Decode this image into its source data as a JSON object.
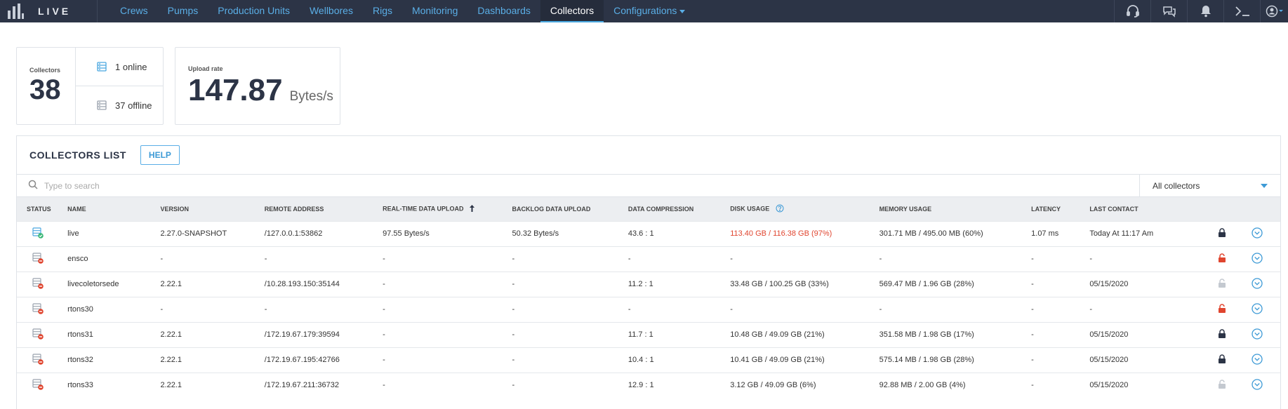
{
  "nav": {
    "brand": "LIVE",
    "items": [
      {
        "label": "Crews"
      },
      {
        "label": "Pumps"
      },
      {
        "label": "Production Units"
      },
      {
        "label": "Wellbores"
      },
      {
        "label": "Rigs"
      },
      {
        "label": "Monitoring"
      },
      {
        "label": "Dashboards"
      },
      {
        "label": "Collectors",
        "active": true
      },
      {
        "label": "Configurations"
      }
    ],
    "right_icons": [
      "headset-icon",
      "chat-icon",
      "bell-icon",
      "terminal-icon",
      "user-icon"
    ]
  },
  "summary": {
    "collectors_label": "Collectors",
    "collectors_count": "38",
    "online": "1 online",
    "offline": "37 offline",
    "upload_label": "Upload rate",
    "upload_value": "147.87",
    "upload_unit": "Bytes/s"
  },
  "list": {
    "title": "COLLECTORS LIST",
    "help_label": "HELP",
    "search_placeholder": "Type to search",
    "filter_value": "All collectors",
    "columns": {
      "status": "STATUS",
      "name": "NAME",
      "version": "VERSION",
      "remote": "REMOTE ADDRESS",
      "realtime": "REAL-TIME DATA UPLOAD",
      "backlog": "BACKLOG DATA UPLOAD",
      "compression": "DATA COMPRESSION",
      "disk": "DISK USAGE",
      "memory": "MEMORY USAGE",
      "latency": "LATENCY",
      "last": "LAST CONTACT"
    },
    "rows": [
      {
        "status": "online",
        "name": "live",
        "version": "2.27.0-SNAPSHOT",
        "remote": "/127.0.0.1:53862",
        "realtime": "97.55 Bytes/s",
        "backlog": "50.32 Bytes/s",
        "compression": "43.6 : 1",
        "disk": "113.40 GB / 116.38 GB (97%)",
        "disk_alert": true,
        "memory": "301.71 MB / 495.00 MB (60%)",
        "latency": "1.07 ms",
        "last": "Today At 11:17 Am",
        "lock": "locked"
      },
      {
        "status": "offline",
        "name": "ensco",
        "version": "-",
        "remote": "-",
        "realtime": "-",
        "backlog": "-",
        "compression": "-",
        "disk": "-",
        "memory": "-",
        "latency": "-",
        "last": "-",
        "lock": "unlocked-alert"
      },
      {
        "status": "offline",
        "name": "livecoletorsede",
        "version": "2.22.1",
        "remote": "/10.28.193.150:35144",
        "realtime": "-",
        "backlog": "-",
        "compression": "11.2 : 1",
        "disk": "33.48 GB / 100.25 GB (33%)",
        "memory": "569.47 MB / 1.96 GB (28%)",
        "latency": "-",
        "last": "05/15/2020",
        "lock": "unlocked"
      },
      {
        "status": "offline",
        "name": "rtons30",
        "version": "-",
        "remote": "-",
        "realtime": "-",
        "backlog": "-",
        "compression": "-",
        "disk": "-",
        "memory": "-",
        "latency": "-",
        "last": "-",
        "lock": "unlocked-alert"
      },
      {
        "status": "offline",
        "name": "rtons31",
        "version": "2.22.1",
        "remote": "/172.19.67.179:39594",
        "realtime": "-",
        "backlog": "-",
        "compression": "11.7 : 1",
        "disk": "10.48 GB / 49.09 GB (21%)",
        "memory": "351.58 MB / 1.98 GB (17%)",
        "latency": "-",
        "last": "05/15/2020",
        "lock": "locked"
      },
      {
        "status": "offline",
        "name": "rtons32",
        "version": "2.22.1",
        "remote": "/172.19.67.195:42766",
        "realtime": "-",
        "backlog": "-",
        "compression": "10.4 : 1",
        "disk": "10.41 GB / 49.09 GB (21%)",
        "memory": "575.14 MB / 1.98 GB (28%)",
        "latency": "-",
        "last": "05/15/2020",
        "lock": "locked"
      },
      {
        "status": "offline",
        "name": "rtons33",
        "version": "2.22.1",
        "remote": "/172.19.67.211:36732",
        "realtime": "-",
        "backlog": "-",
        "compression": "12.9 : 1",
        "disk": "3.12 GB / 49.09 GB (6%)",
        "memory": "92.88 MB / 2.00 GB (4%)",
        "latency": "-",
        "last": "05/15/2020",
        "lock": "unlocked"
      }
    ]
  },
  "colors": {
    "nav_bg": "#2c3446",
    "link": "#5aaee6",
    "alert": "#e0452f",
    "online": "#3cb878"
  }
}
